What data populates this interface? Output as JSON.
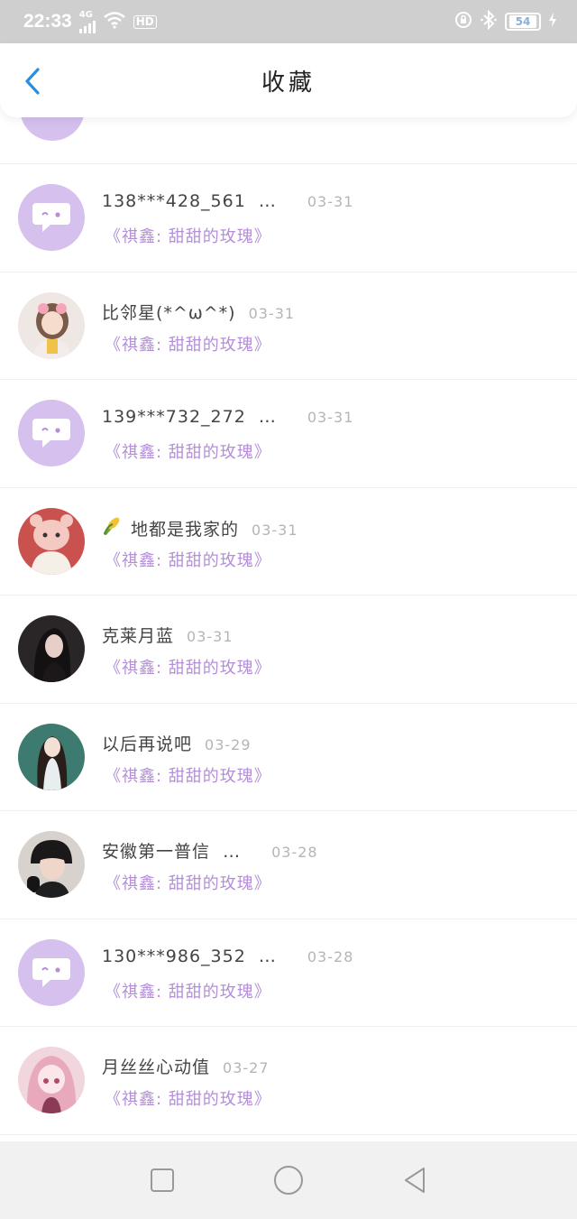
{
  "status_bar": {
    "time": "22:33",
    "network": "4G",
    "hd": "HD",
    "battery": "54"
  },
  "header": {
    "title": "收藏",
    "back_icon": "chevron-left-icon",
    "accent_color": "#2a8ee0"
  },
  "favorites": [
    {
      "name": "138***428_561  …",
      "date": "03-31",
      "source": "《祺鑫:  甜甜的玫瑰》",
      "avatar": "default-chat-avatar"
    },
    {
      "name": "比邻星(*^ω^*)",
      "date": "03-31",
      "source": "《祺鑫:  甜甜的玫瑰》",
      "avatar": "girl-photo-avatar"
    },
    {
      "name": "139***732_272  …",
      "date": "03-31",
      "source": "《祺鑫:  甜甜的玫瑰》",
      "avatar": "default-chat-avatar"
    },
    {
      "name": "地都是我家的",
      "date": "03-31",
      "source": "《祺鑫:  甜甜的玫瑰》",
      "avatar": "plush-toy-avatar",
      "emoji": "corn-emoji"
    },
    {
      "name": "克莱月蓝",
      "date": "03-31",
      "source": "《祺鑫:  甜甜的玫瑰》",
      "avatar": "dark-portrait-avatar"
    },
    {
      "name": "以后再说吧",
      "date": "03-29",
      "source": "《祺鑫:  甜甜的玫瑰》",
      "avatar": "anime-girl-avatar"
    },
    {
      "name": "安徽第一普信  …",
      "date": "03-28",
      "source": "《祺鑫:  甜甜的玫瑰》",
      "avatar": "boy-headphones-avatar"
    },
    {
      "name": "130***986_352  …",
      "date": "03-28",
      "source": "《祺鑫:  甜甜的玫瑰》",
      "avatar": "default-chat-avatar"
    },
    {
      "name": "月丝丝心动值",
      "date": "03-27",
      "source": "《祺鑫:  甜甜的玫瑰》",
      "avatar": "pink-anime-avatar"
    }
  ],
  "colors": {
    "subtitle": "#b48fd8",
    "default_avatar": "#d5c0ee",
    "date": "#b5b5b5"
  },
  "nav": {
    "recent_icon": "square-icon",
    "home_icon": "circle-icon",
    "back_icon": "triangle-back-icon"
  }
}
